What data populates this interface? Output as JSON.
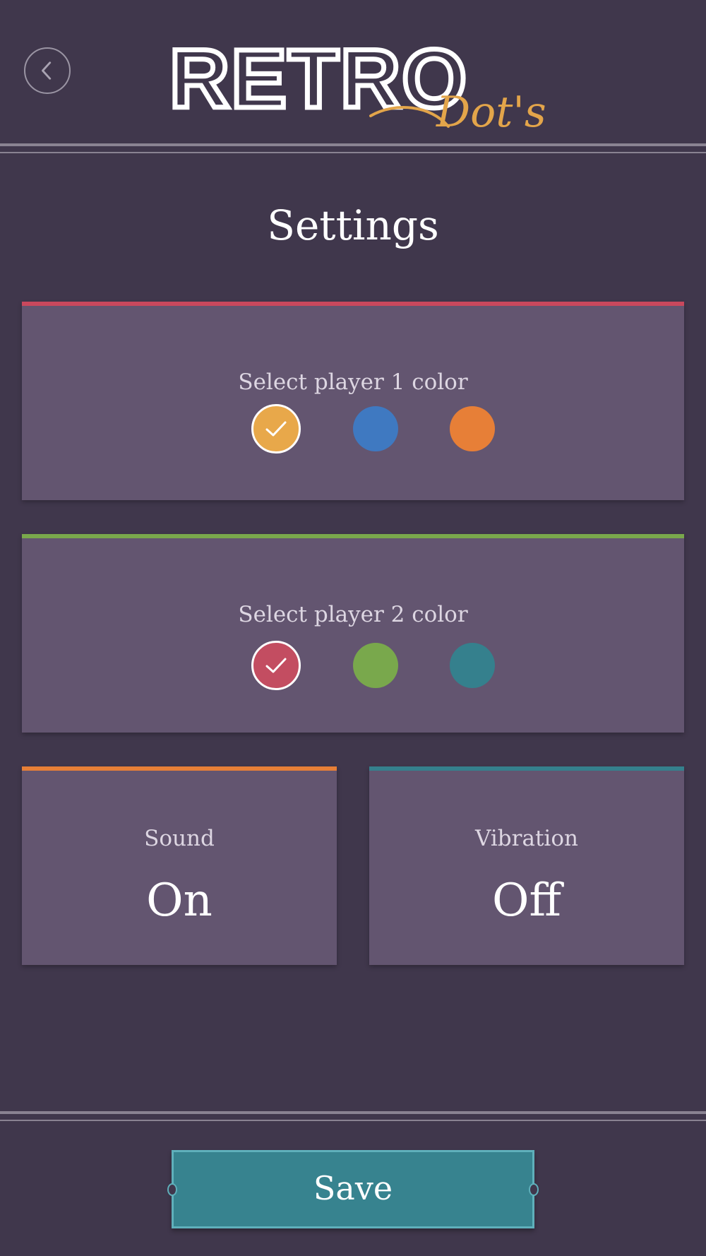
{
  "header": {
    "logo_main": "RETRO",
    "logo_script": "Dot's"
  },
  "page": {
    "title": "Settings"
  },
  "player1": {
    "label": "Select player 1 color",
    "accent_color": "#c9485d",
    "colors": [
      "#e8a84a",
      "#3f79c1",
      "#e77f37"
    ],
    "selected_index": 0
  },
  "player2": {
    "label": "Select player 2 color",
    "accent_color": "#79a84c",
    "colors": [
      "#c34d61",
      "#79a84c",
      "#35808d"
    ],
    "selected_index": 0
  },
  "sound": {
    "label": "Sound",
    "value": "On",
    "accent_color": "#e77f37"
  },
  "vibration": {
    "label": "Vibration",
    "value": "Off",
    "accent_color": "#35808d"
  },
  "footer": {
    "save_label": "Save"
  },
  "icons": {
    "back": "chevron-left-icon",
    "selected": "checkmark-icon"
  }
}
